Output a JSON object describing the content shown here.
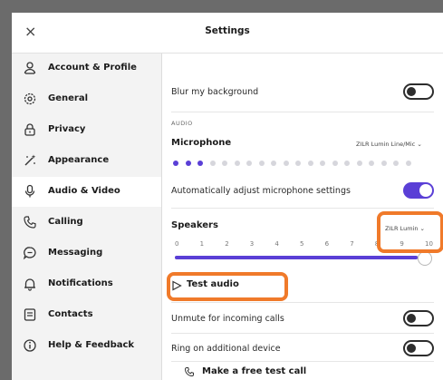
{
  "window": {
    "title": "Settings",
    "close_glyph": "×"
  },
  "sidebar": {
    "items": [
      {
        "label": "Account & Profile",
        "icon": "person-icon"
      },
      {
        "label": "General",
        "icon": "gear-icon"
      },
      {
        "label": "Privacy",
        "icon": "lock-icon"
      },
      {
        "label": "Appearance",
        "icon": "magic-wand-icon"
      },
      {
        "label": "Audio & Video",
        "icon": "microphone-icon",
        "active": true
      },
      {
        "label": "Calling",
        "icon": "phone-icon"
      },
      {
        "label": "Messaging",
        "icon": "chat-icon"
      },
      {
        "label": "Notifications",
        "icon": "bell-icon"
      },
      {
        "label": "Contacts",
        "icon": "contacts-icon"
      },
      {
        "label": "Help & Feedback",
        "icon": "info-icon"
      }
    ]
  },
  "content": {
    "blur_label": "Blur my background",
    "blur_on": false,
    "audio_section": "AUDIO",
    "microphone_label": "Microphone",
    "microphone_device": "ZILR Lumin Line/Mic",
    "mic_level_active_dots": 3,
    "mic_level_total_dots": 20,
    "auto_adjust_label": "Automatically adjust microphone settings",
    "auto_adjust_on": true,
    "speakers_label": "Speakers",
    "speakers_device": "ZILR Lumin",
    "speaker_ticks": [
      "0",
      "1",
      "2",
      "3",
      "4",
      "5",
      "6",
      "7",
      "8",
      "9",
      "10"
    ],
    "speaker_volume": 10,
    "test_audio_label": "Test audio",
    "unmute_label": "Unmute for incoming calls",
    "unmute_on": false,
    "ring_label": "Ring on additional device",
    "ring_on": false,
    "test_call_label": "Make a free test call"
  },
  "colors": {
    "accent": "#5a3fd6",
    "highlight": "#f07a2a"
  }
}
